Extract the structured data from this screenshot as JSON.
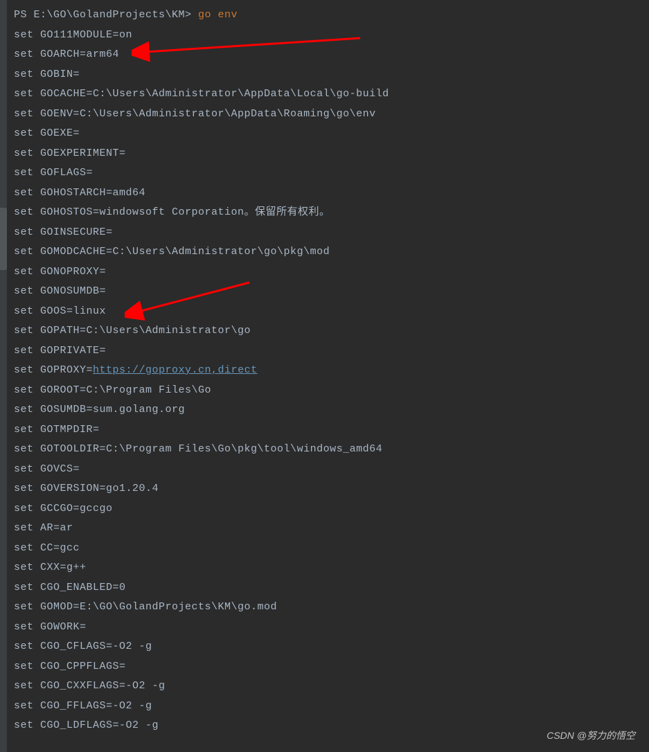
{
  "prompt": "PS E:\\GO\\GolandProjects\\KM> ",
  "command": "go env",
  "lines": [
    "set GO111MODULE=on",
    "set GOARCH=arm64",
    "set GOBIN=",
    "set GOCACHE=C:\\Users\\Administrator\\AppData\\Local\\go-build",
    "set GOENV=C:\\Users\\Administrator\\AppData\\Roaming\\go\\env",
    "set GOEXE=",
    "set GOEXPERIMENT=",
    "set GOFLAGS=",
    "set GOHOSTARCH=amd64",
    "set GOHOSTOS=windowsoft Corporation。保留所有权利。",
    "set GOINSECURE=",
    "set GOMODCACHE=C:\\Users\\Administrator\\go\\pkg\\mod",
    "set GONOPROXY=",
    "set GONOSUMDB=",
    "set GOOS=linux",
    "set GOPATH=C:\\Users\\Administrator\\go",
    "set GOPRIVATE=",
    "",
    "set GOROOT=C:\\Program Files\\Go",
    "set GOSUMDB=sum.golang.org",
    "set GOTMPDIR=",
    "set GOTOOLDIR=C:\\Program Files\\Go\\pkg\\tool\\windows_amd64",
    "set GOVCS=",
    "set GOVERSION=go1.20.4",
    "set GCCGO=gccgo",
    "set AR=ar",
    "set CC=gcc",
    "set CXX=g++",
    "set CGO_ENABLED=0",
    "set GOMOD=E:\\GO\\GolandProjects\\KM\\go.mod",
    "set GOWORK=",
    "set CGO_CFLAGS=-O2 -g",
    "set CGO_CPPFLAGS=",
    "set CGO_CXXFLAGS=-O2 -g",
    "set CGO_FFLAGS=-O2 -g",
    "set CGO_LDFLAGS=-O2 -g"
  ],
  "proxy_line": {
    "prefix": "set GOPROXY=",
    "url": "https://goproxy.cn,direct"
  },
  "watermark": "CSDN @努力的悟空",
  "arrows": [
    {
      "target": "GOARCH=arm64"
    },
    {
      "target": "GOOS=linux"
    }
  ]
}
